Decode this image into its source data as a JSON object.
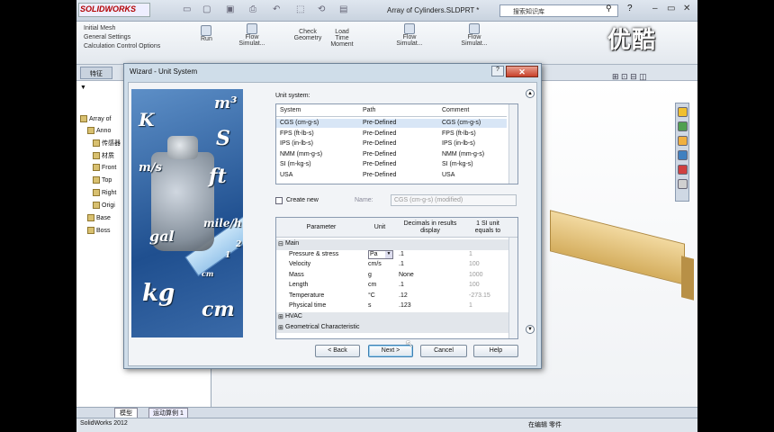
{
  "app": {
    "logo": "SOLIDWORKS",
    "doc_title": "Array of Cylinders.SLDPRT *",
    "search_placeholder": "搜索知识库",
    "help": "?"
  },
  "ribbon": {
    "items": [
      "Initial Mesh",
      "General Settings",
      "Calculation Control Options"
    ],
    "run": "Run",
    "flow_sim_1": "Flow Simulat...",
    "check_geometry": "Check Geometry",
    "load_time": "Load Time Moment",
    "flow_sim_2": "Flow Simulat...",
    "flow_sim_3": "Flow Simulat..."
  },
  "watermark": "优酷",
  "feature_tab": "特征",
  "tree": {
    "root": "Array of",
    "items": [
      "Anno",
      "传感器",
      "材质",
      "Front",
      "Top",
      "Right",
      "Origi",
      "Base",
      "Boss"
    ]
  },
  "bottom_tabs": [
    "模型",
    "运动算例 1"
  ],
  "status": {
    "left": "SolidWorks 2012",
    "right": "在编辑 零件"
  },
  "dialog": {
    "title": "Wizard - Unit System",
    "help_label": "?",
    "close_label": "✕",
    "art_units": [
      "K",
      "m³",
      "S",
      "m/s",
      "ft",
      "gal",
      "mile/h",
      "kg",
      "cm",
      "1",
      "2",
      "cm"
    ],
    "unit_system_label": "Unit system:",
    "unit_columns": [
      "System",
      "Path",
      "Comment"
    ],
    "unit_rows": [
      [
        "CGS (cm-g-s)",
        "Pre-Defined",
        "CGS (cm-g-s)"
      ],
      [
        "FPS (ft-lb-s)",
        "Pre-Defined",
        "FPS (ft-lb-s)"
      ],
      [
        "IPS (in-lb-s)",
        "Pre-Defined",
        "IPS (in-lb-s)"
      ],
      [
        "NMM (mm-g-s)",
        "Pre-Defined",
        "NMM (mm-g-s)"
      ],
      [
        "SI (m-kg-s)",
        "Pre-Defined",
        "SI (m-kg-s)"
      ],
      [
        "USA",
        "Pre-Defined",
        "USA"
      ]
    ],
    "create_new_label": "Create new",
    "name_label": "Name:",
    "name_value": "CGS (cm-g-s) (modified)",
    "param_columns": [
      "Parameter",
      "Unit",
      "Decimals in results display",
      "1 SI unit equals to"
    ],
    "group_main": "Main",
    "params": [
      [
        "Pressure & stress",
        "Pa",
        ".1",
        "1"
      ],
      [
        "Velocity",
        "cm/s",
        ".1",
        "100"
      ],
      [
        "Mass",
        "g",
        "None",
        "1000"
      ],
      [
        "Length",
        "cm",
        ".1",
        "100"
      ],
      [
        "Temperature",
        "°C",
        ".12",
        "-273.15"
      ],
      [
        "Physical time",
        "s",
        ".123",
        "1"
      ]
    ],
    "group_hvac": "HVAC",
    "group_geom": "Geometrical Characteristic",
    "buttons": {
      "back": "< Back",
      "next": "Next >",
      "cancel": "Cancel",
      "help": "Help"
    }
  }
}
